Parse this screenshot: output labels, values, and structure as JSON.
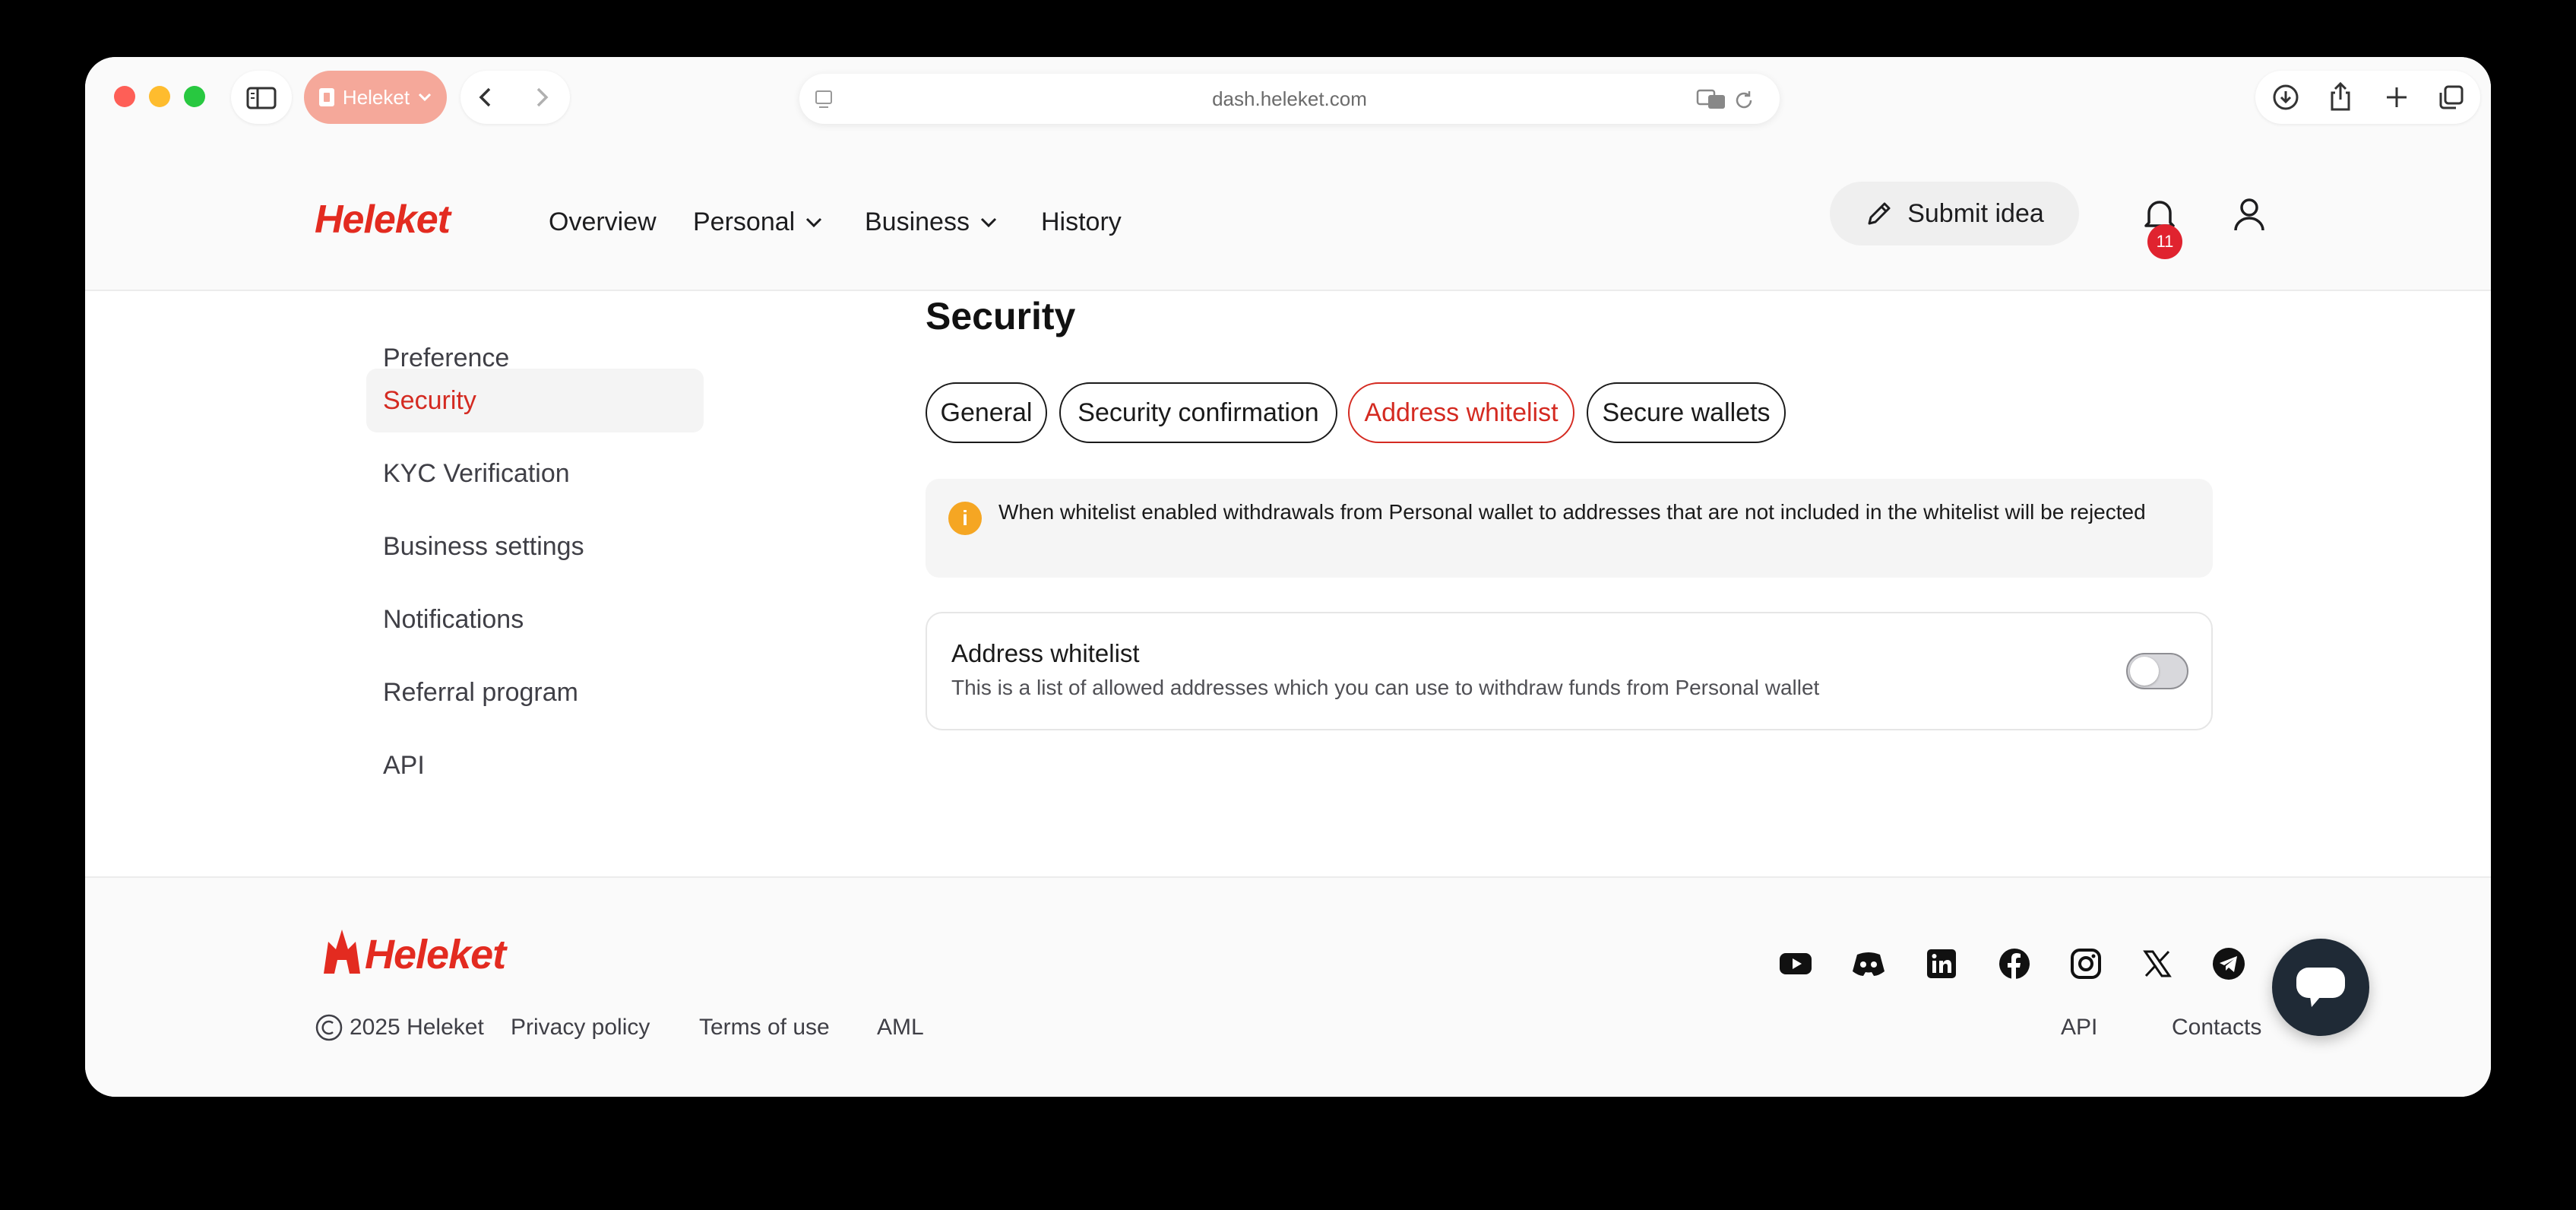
{
  "browser": {
    "tab_label": "Heleket",
    "url": "dash.heleket.com",
    "traffic_lights": [
      "#fe5f57",
      "#febc2e",
      "#28c840"
    ]
  },
  "header": {
    "logo": "Heleket",
    "nav": [
      {
        "label": "Overview"
      },
      {
        "label": "Personal"
      },
      {
        "label": "Business"
      },
      {
        "label": "History"
      }
    ],
    "submit_idea": "Submit idea",
    "notifications_count": "11"
  },
  "sidebar": {
    "items": [
      {
        "label": "Preference"
      },
      {
        "label": "Security"
      },
      {
        "label": "KYC Verification"
      },
      {
        "label": "Business settings"
      },
      {
        "label": "Notifications"
      },
      {
        "label": "Referral program"
      },
      {
        "label": "API"
      }
    ],
    "active": "Security"
  },
  "main": {
    "title": "Security",
    "tabs": [
      {
        "label": "General"
      },
      {
        "label": "Security confirmation"
      },
      {
        "label": "Address whitelist"
      },
      {
        "label": "Secure wallets"
      }
    ],
    "active_tab": "Address whitelist",
    "notice": "When whitelist enabled withdrawals from Personal wallet to addresses that are not included in the whitelist will be rejected",
    "whitelist": {
      "title": "Address whitelist",
      "description": "This is a list of allowed addresses which you can use to withdraw funds from Personal wallet",
      "enabled": false
    }
  },
  "footer": {
    "logo": "Heleket",
    "copyright": "2025 Heleket",
    "links_left": [
      "Privacy policy",
      "Terms of use",
      "AML"
    ],
    "links_right": [
      "API",
      "Contacts"
    ],
    "social_icons": [
      "youtube-icon",
      "discord-icon",
      "linkedin-icon",
      "facebook-icon",
      "instagram-icon",
      "x-icon",
      "telegram-icon"
    ]
  },
  "colors": {
    "brand": "#e32b20",
    "accent_active": "#d42a21",
    "notice_icon": "#f5a623",
    "badge": "#e0232f",
    "chat_button": "#1f2a36"
  }
}
